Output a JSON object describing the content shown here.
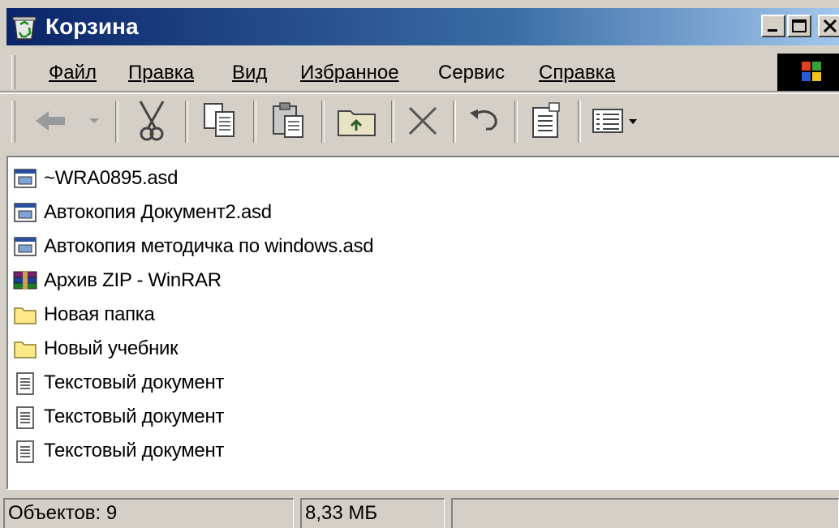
{
  "window": {
    "title": "Корзина",
    "icon": "recycle-bin-icon"
  },
  "menu": [
    {
      "label": "Файл",
      "id": "file"
    },
    {
      "label": "Правка",
      "id": "edit"
    },
    {
      "label": "Вид",
      "id": "view"
    },
    {
      "label": "Избранное",
      "id": "favorites"
    },
    {
      "label": "Сервис",
      "id": "tools"
    },
    {
      "label": "Справка",
      "id": "help"
    }
  ],
  "toolbar": [
    {
      "icon": "back-arrow-icon"
    },
    {
      "icon": "cut-icon"
    },
    {
      "icon": "copy-icon"
    },
    {
      "icon": "paste-icon"
    },
    {
      "icon": "up-folder-icon"
    },
    {
      "icon": "delete-icon"
    },
    {
      "icon": "undo-icon"
    },
    {
      "icon": "properties-icon"
    },
    {
      "icon": "views-icon"
    }
  ],
  "files": [
    {
      "name": "~WRA0895.asd",
      "icon": "asd-file-icon"
    },
    {
      "name": "Автокопия Документ2.asd",
      "icon": "asd-file-icon"
    },
    {
      "name": "Автокопия методичка  по windows.asd",
      "icon": "asd-file-icon"
    },
    {
      "name": "Архив ZIP - WinRAR",
      "icon": "winrar-archive-icon"
    },
    {
      "name": "Новая папка",
      "icon": "folder-icon"
    },
    {
      "name": "Новый учебник",
      "icon": "folder-icon"
    },
    {
      "name": "Текстовый документ",
      "icon": "text-document-icon"
    },
    {
      "name": "Текстовый документ",
      "icon": "text-document-icon"
    },
    {
      "name": "Текстовый документ",
      "icon": "text-document-icon"
    }
  ],
  "status": {
    "objects": "Объектов: 9",
    "size": "8,33 МБ",
    "extra": ""
  },
  "colors": {
    "titlebar_start": "#0a246a",
    "titlebar_end": "#a6caf0",
    "face": "#d4d0c8"
  }
}
